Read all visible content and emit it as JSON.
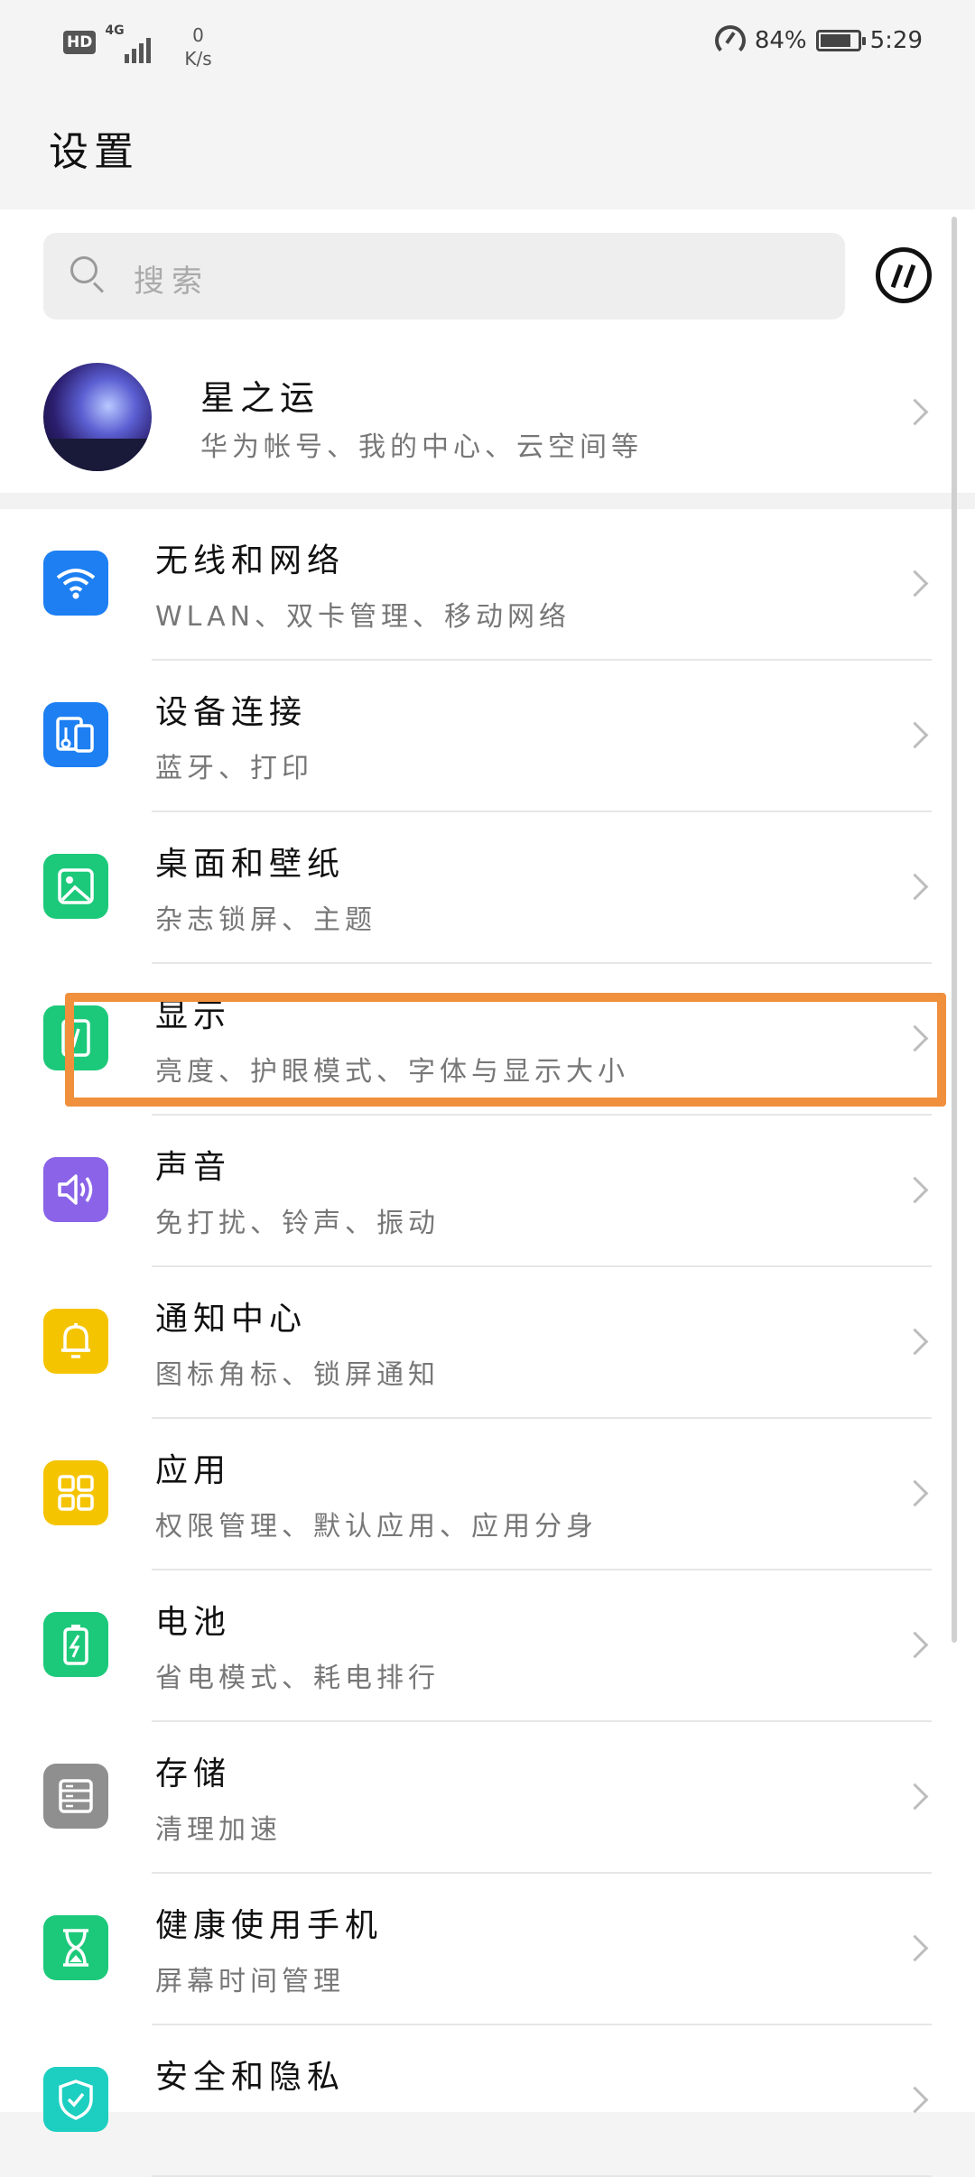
{
  "status_bar": {
    "hd": "HD",
    "network": "4G",
    "speed_value": "0",
    "speed_unit": "K/s",
    "battery": "84%",
    "time": "5:29",
    "battery_level": 0.84
  },
  "title": "设置",
  "search": {
    "placeholder": "搜索",
    "icon": "search-icon"
  },
  "account": {
    "name": "星之运",
    "subtitle": "华为帐号、我的中心、云空间等"
  },
  "items": [
    {
      "title": "无线和网络",
      "subtitle": "WLAN、双卡管理、移动网络",
      "color": "#1d7ff2",
      "icon": "wifi-icon"
    },
    {
      "title": "设备连接",
      "subtitle": "蓝牙、打印",
      "color": "#1d7ff2",
      "icon": "device-connection-icon"
    },
    {
      "title": "桌面和壁纸",
      "subtitle": "杂志锁屏、主题",
      "color": "#1cc97a",
      "icon": "wallpaper-icon"
    },
    {
      "title": "显示",
      "subtitle": "亮度、护眼模式、字体与显示大小",
      "color": "#1cc97a",
      "icon": "display-icon"
    },
    {
      "title": "声音",
      "subtitle": "免打扰、铃声、振动",
      "color": "#8a63e8",
      "icon": "sound-icon"
    },
    {
      "title": "通知中心",
      "subtitle": "图标角标、锁屏通知",
      "color": "#f5c400",
      "icon": "bell-icon"
    },
    {
      "title": "应用",
      "subtitle": "权限管理、默认应用、应用分身",
      "color": "#f5c400",
      "icon": "apps-icon"
    },
    {
      "title": "电池",
      "subtitle": "省电模式、耗电排行",
      "color": "#1cc97a",
      "icon": "battery-icon"
    },
    {
      "title": "存储",
      "subtitle": "清理加速",
      "color": "#8f8f8f",
      "icon": "storage-icon"
    },
    {
      "title": "健康使用手机",
      "subtitle": "屏幕时间管理",
      "color": "#1cc97a",
      "icon": "hourglass-icon"
    },
    {
      "title": "安全和隐私",
      "subtitle": "",
      "color": "#1ccfc0",
      "icon": "shield-icon"
    }
  ],
  "highlight_color": "#f0903d"
}
